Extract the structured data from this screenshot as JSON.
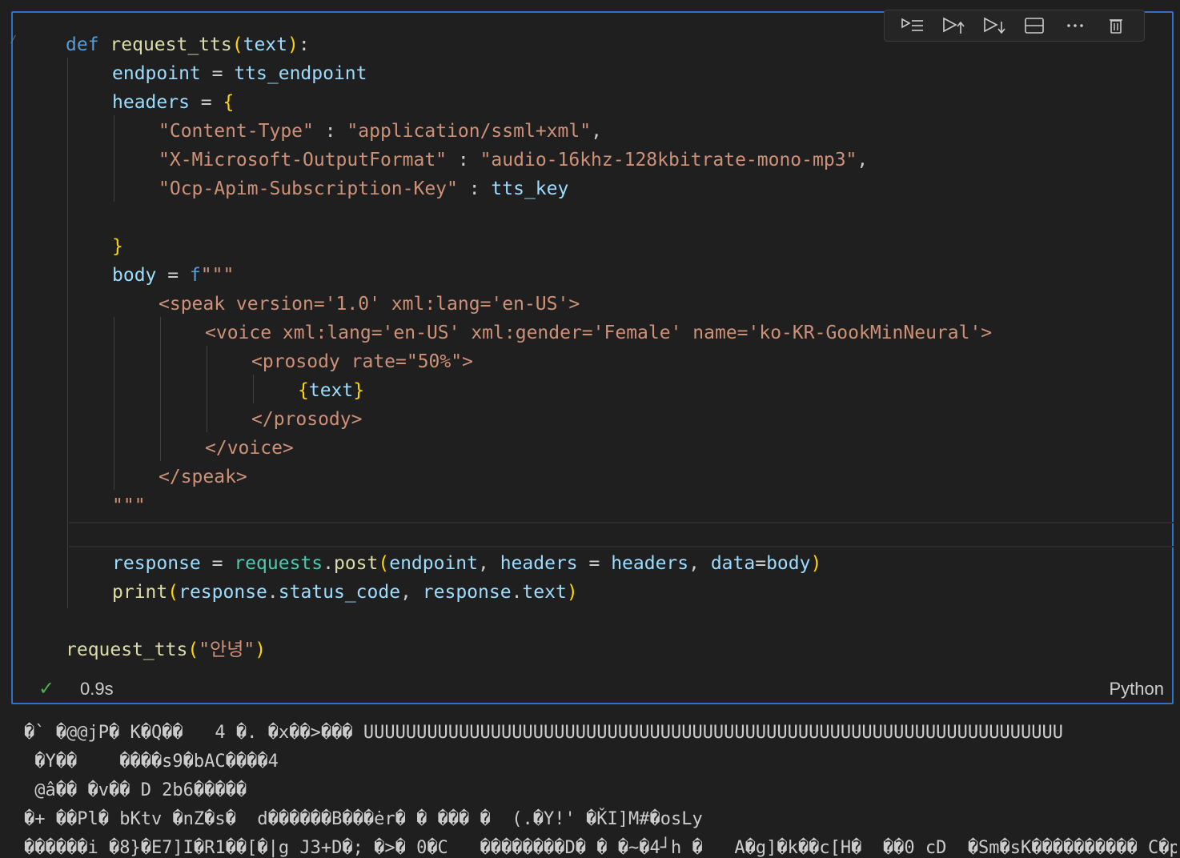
{
  "toolbar": {
    "buttons": [
      {
        "icon": "execute-above-icon",
        "label": "Execute Above Cells"
      },
      {
        "icon": "run-above-icon",
        "label": "Run Above"
      },
      {
        "icon": "run-below-icon",
        "label": "Run Below"
      },
      {
        "icon": "split-cell-icon",
        "label": "Split Cell"
      },
      {
        "icon": "more-icon",
        "label": "More"
      },
      {
        "icon": "delete-icon",
        "label": "Delete"
      }
    ]
  },
  "code": {
    "l1_def": "def",
    "l1_fn": "request_tts",
    "l1_open": "(",
    "l1_arg": "text",
    "l1_close": ")",
    "l1_colon": ":",
    "l2_var": "endpoint",
    "l2_eq": " = ",
    "l2_val": "tts_endpoint",
    "l3_var": "headers",
    "l3_eq": " = ",
    "l3_brace": "{",
    "l4_key": "\"Content-Type\"",
    "l4_sep": " : ",
    "l4_val": "\"application/ssml+xml\"",
    "l4_comma": ",",
    "l5_key": "\"X-Microsoft-OutputFormat\"",
    "l5_sep": " : ",
    "l5_val": "\"audio-16khz-128kbitrate-mono-mp3\"",
    "l5_comma": ",",
    "l6_key": "\"Ocp-Apim-Subscription-Key\"",
    "l6_sep": " : ",
    "l6_val": "tts_key",
    "l8_brace": "}",
    "l9_var": "body",
    "l9_eq": " = ",
    "l9_f": "f",
    "l9_str": "\"\"\"",
    "l10": "<speak version='1.0' xml:lang='en-US'>",
    "l11": "<voice xml:lang='en-US' xml:gender='Female' name='ko-KR-GookMinNeural'>",
    "l12": "<prosody rate=\"50%\">",
    "l13_open": "{",
    "l13_text": "text",
    "l13_close": "}",
    "l14": "</prosody>",
    "l15": "</voice>",
    "l16": "</speak>",
    "l17": "\"\"\"",
    "l19_var": "response",
    "l19_eq": " = ",
    "l19_mod": "requests",
    "l19_dot": ".",
    "l19_fn": "post",
    "l19_open": "(",
    "l19_a1": "endpoint",
    "l19_c1": ", ",
    "l19_a2": "headers",
    "l19_eq2": " = ",
    "l19_a3": "headers",
    "l19_c2": ", ",
    "l19_a4": "data",
    "l19_eq3": "=",
    "l19_a5": "body",
    "l19_close": ")",
    "l20_fn": "print",
    "l20_open": "(",
    "l20_a1": "response",
    "l20_dot1": ".",
    "l20_a2": "status_code",
    "l20_comma": ", ",
    "l20_a3": "response",
    "l20_dot2": ".",
    "l20_a4": "text",
    "l20_close": ")",
    "l22_fn": "request_tts",
    "l22_open": "(",
    "l22_str": "\"안녕\"",
    "l22_close": ")"
  },
  "status": {
    "check_icon": "check-icon",
    "time": "0.9s",
    "language": "Python"
  },
  "output": {
    "lines": [
      "�` �@@jP� K�Q��   4 �. �x��>��� UUUUUUUUUUUUUUUUUUUUUUUUUUUUUUUUUUUUUUUUUUUUUUUUUUUUUUUUUUUUUUUUUU",
      " �Y��    ����s9�bAC����4",
      " @â�� �v�� D 2b6�����",
      "�+ ��Pl� bKtv �nZ�s�  d������B���ėr� � ��� �  (.�Y!' �ǨI]M#�osLy",
      "������i �8}�E7]I�R1��[�|g J3+D�; �>� 0�C   ��������D� � �~�4┘h �   A�g]�k��c[H�  ��0 cD  �Sm�sK���������� C�p"
    ]
  }
}
